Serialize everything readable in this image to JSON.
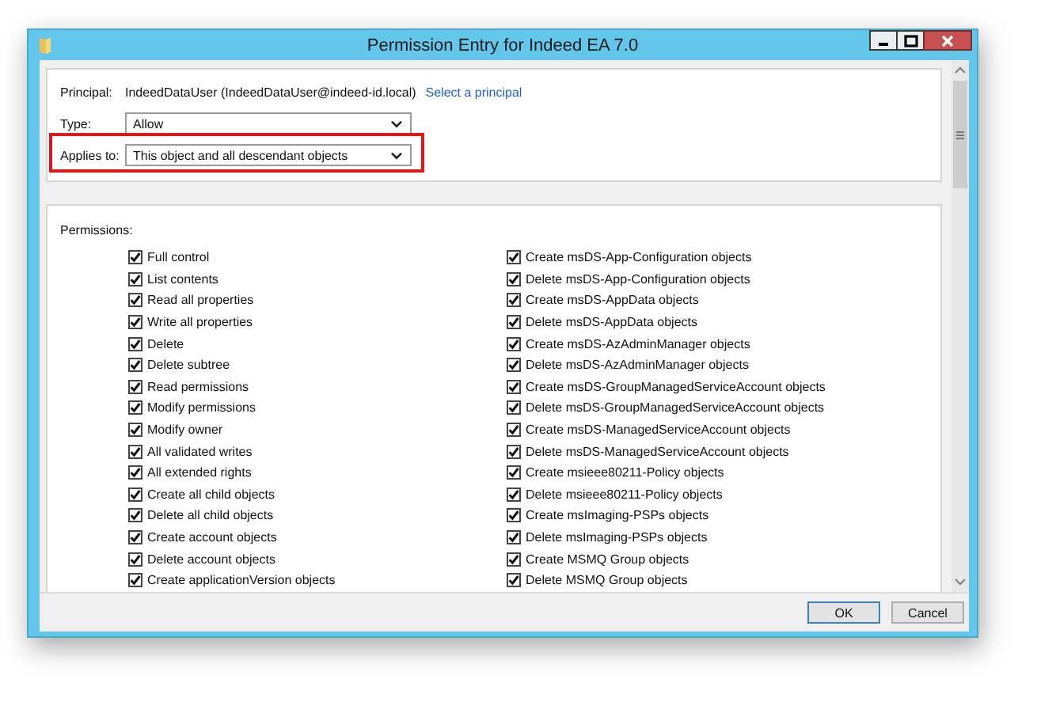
{
  "window": {
    "title": "Permission Entry for Indeed EA 7.0"
  },
  "principal": {
    "label": "Principal:",
    "value": "IndeedDataUser (IndeedDataUser@indeed-id.local)",
    "link": "Select a principal"
  },
  "type": {
    "label": "Type:",
    "value": "Allow"
  },
  "applies_to": {
    "label": "Applies to:",
    "value": "This object and all descendant objects",
    "highlighted": true
  },
  "permissions": {
    "label": "Permissions:",
    "columns": [
      {
        "items": [
          {
            "label": "Full control",
            "checked": true
          },
          {
            "label": "List contents",
            "checked": true
          },
          {
            "label": "Read all properties",
            "checked": true
          },
          {
            "label": "Write all properties",
            "checked": true
          },
          {
            "label": "Delete",
            "checked": true
          },
          {
            "label": "Delete subtree",
            "checked": true
          },
          {
            "label": "Read permissions",
            "checked": true
          },
          {
            "label": "Modify permissions",
            "checked": true
          },
          {
            "label": "Modify owner",
            "checked": true
          },
          {
            "label": "All validated writes",
            "checked": true
          },
          {
            "label": "All extended rights",
            "checked": true
          },
          {
            "label": "Create all child objects",
            "checked": true
          },
          {
            "label": "Delete all child objects",
            "checked": true
          },
          {
            "label": "Create account objects",
            "checked": true
          },
          {
            "label": "Delete account objects",
            "checked": true
          },
          {
            "label": "Create applicationVersion objects",
            "checked": true
          }
        ]
      },
      {
        "items": [
          {
            "label": "Create msDS-App-Configuration objects",
            "checked": true
          },
          {
            "label": "Delete msDS-App-Configuration objects",
            "checked": true
          },
          {
            "label": "Create msDS-AppData objects",
            "checked": true
          },
          {
            "label": "Delete msDS-AppData objects",
            "checked": true
          },
          {
            "label": "Create msDS-AzAdminManager objects",
            "checked": true
          },
          {
            "label": "Delete msDS-AzAdminManager objects",
            "checked": true
          },
          {
            "label": "Create msDS-GroupManagedServiceAccount objects",
            "checked": true
          },
          {
            "label": "Delete msDS-GroupManagedServiceAccount objects",
            "checked": true
          },
          {
            "label": "Create msDS-ManagedServiceAccount objects",
            "checked": true
          },
          {
            "label": "Delete msDS-ManagedServiceAccount objects",
            "checked": true
          },
          {
            "label": "Create msieee80211-Policy objects",
            "checked": true
          },
          {
            "label": "Delete msieee80211-Policy objects",
            "checked": true
          },
          {
            "label": "Create msImaging-PSPs objects",
            "checked": true
          },
          {
            "label": "Delete msImaging-PSPs objects",
            "checked": true
          },
          {
            "label": "Create MSMQ Group objects",
            "checked": true
          },
          {
            "label": "Delete MSMQ Group objects",
            "checked": true
          }
        ]
      }
    ]
  },
  "buttons": [
    {
      "label": "OK",
      "default": true
    },
    {
      "label": "Cancel",
      "default": false
    }
  ]
}
